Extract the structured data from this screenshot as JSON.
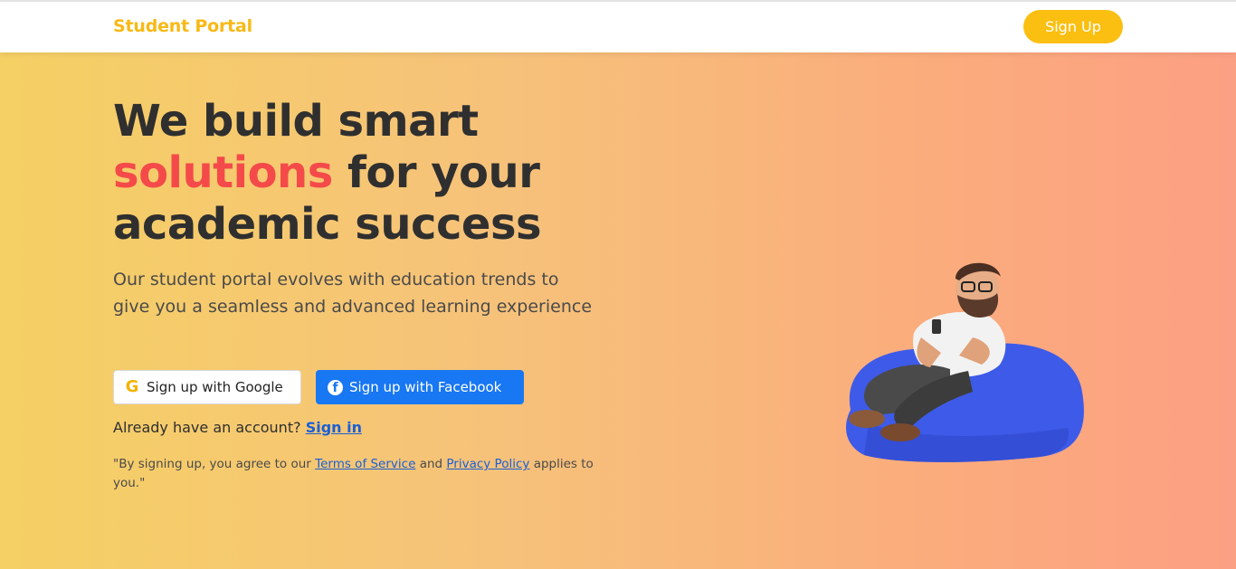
{
  "navbar": {
    "brand": "Student Portal",
    "signup_label": "Sign Up"
  },
  "hero": {
    "headline_line1": "We build smart",
    "headline_accent": "solutions",
    "headline_line2_rest": " for your",
    "headline_line3": "academic success",
    "subtext": "Our student portal evolves with education trends to give you a seamless and advanced learning experience",
    "google_button": {
      "icon": "google-icon",
      "label": "Sign up with Google"
    },
    "facebook_button": {
      "icon": "facebook-icon",
      "label": "Sign up with Facebook"
    },
    "account_prompt": "Already have an account?",
    "signin_link": "Sign in",
    "legal_prefix": "\"By signing up, you agree to our",
    "terms_link": "Terms of Service",
    "legal_and": "and",
    "privacy_link": "Privacy Policy",
    "legal_suffix": "applies to you.\""
  },
  "colors": {
    "brand": "#f7b916",
    "signup_button": "#fbbf11",
    "accent_text": "#f44a4a",
    "facebook_blue": "#1877f2",
    "link": "#1a5fd6",
    "gradient_start": "#f5d064",
    "gradient_end": "#fca083",
    "beanbag": "#3d5be8"
  }
}
